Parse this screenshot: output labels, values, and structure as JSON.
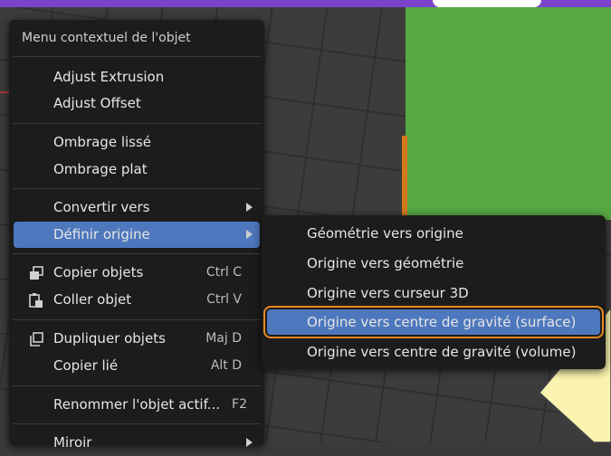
{
  "menu": {
    "title": "Menu contextuel de l'objet",
    "items": [
      {
        "label": "Adjust Extrusion"
      },
      {
        "label": "Adjust Offset"
      },
      {
        "label": "Ombrage lissé"
      },
      {
        "label": "Ombrage plat"
      },
      {
        "label": "Convertir vers",
        "has_submenu": true
      },
      {
        "label": "Définir origine",
        "has_submenu": true,
        "active": true
      },
      {
        "label": "Copier objets",
        "shortcut": "Ctrl C",
        "icon": "copy-icon"
      },
      {
        "label": "Coller objet",
        "shortcut": "Ctrl V",
        "icon": "paste-icon"
      },
      {
        "label": "Dupliquer objets",
        "shortcut": "Maj D",
        "icon": "duplicate-icon"
      },
      {
        "label": "Copier lié",
        "shortcut": "Alt D"
      },
      {
        "label": "Renommer l'objet actif...",
        "shortcut": "F2"
      },
      {
        "label": "Miroir",
        "has_submenu": true
      }
    ]
  },
  "submenu": {
    "items": [
      {
        "label": "Géométrie vers origine"
      },
      {
        "label": "Origine vers géométrie"
      },
      {
        "label": "Origine vers curseur 3D"
      },
      {
        "label": "Origine vers centre de gravité (surface)",
        "highlighted": true
      },
      {
        "label": "Origine vers centre de gravité (volume)"
      }
    ]
  },
  "colors": {
    "menu_bg": "#1c1c1c",
    "active_item": "#4e78bd",
    "highlight_outline": "#e8891e",
    "green_object": "#56a843",
    "top_bar": "#7a43c9",
    "callout": "#fbf4b0"
  }
}
